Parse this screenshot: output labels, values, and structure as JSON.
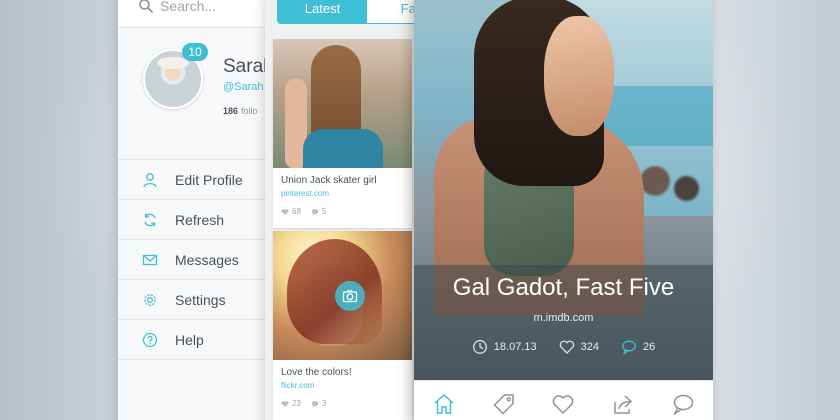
{
  "colors": {
    "accent": "#3fbfd6",
    "text_dark": "#4a5158",
    "text_muted": "#9aa4ab",
    "menu_bg": "#f7f8f9",
    "overlay": "rgba(60,72,78,0.55)"
  },
  "sidebar": {
    "search": {
      "placeholder": "Search...",
      "icon": "search-icon"
    },
    "profile": {
      "name": "Saral",
      "handle": "@Sarah",
      "badge_count": "10",
      "followers_count": "186",
      "followers_label": "follo"
    },
    "menu": [
      {
        "label": "Edit Profile",
        "icon": "user-icon"
      },
      {
        "label": "Refresh",
        "icon": "refresh-icon"
      },
      {
        "label": "Messages",
        "icon": "mail-icon"
      },
      {
        "label": "Settings",
        "icon": "gear-icon"
      },
      {
        "label": "Help",
        "icon": "help-icon"
      }
    ]
  },
  "feed": {
    "tabs": [
      {
        "label": "Latest",
        "active": true
      },
      {
        "label": "Fav",
        "active": false
      }
    ],
    "cards": [
      {
        "title": "Union Jack skater girl",
        "source": "pinterest.com",
        "likes": "68",
        "comments": "5"
      },
      {
        "title": "Love the colors!",
        "source": "flickr.com",
        "likes": "23",
        "comments": "3",
        "has_camera": true
      }
    ]
  },
  "detail": {
    "title": "Gal Gadot, Fast Five",
    "source": "m.imdb.com",
    "date": "18.07.13",
    "likes": "324",
    "comments": "26"
  },
  "bottom_nav": [
    {
      "icon": "home-icon",
      "active": true
    },
    {
      "icon": "tag-icon",
      "active": false
    },
    {
      "icon": "heart-icon",
      "active": false
    },
    {
      "icon": "share-icon",
      "active": false
    },
    {
      "icon": "chat-icon",
      "active": false
    }
  ]
}
